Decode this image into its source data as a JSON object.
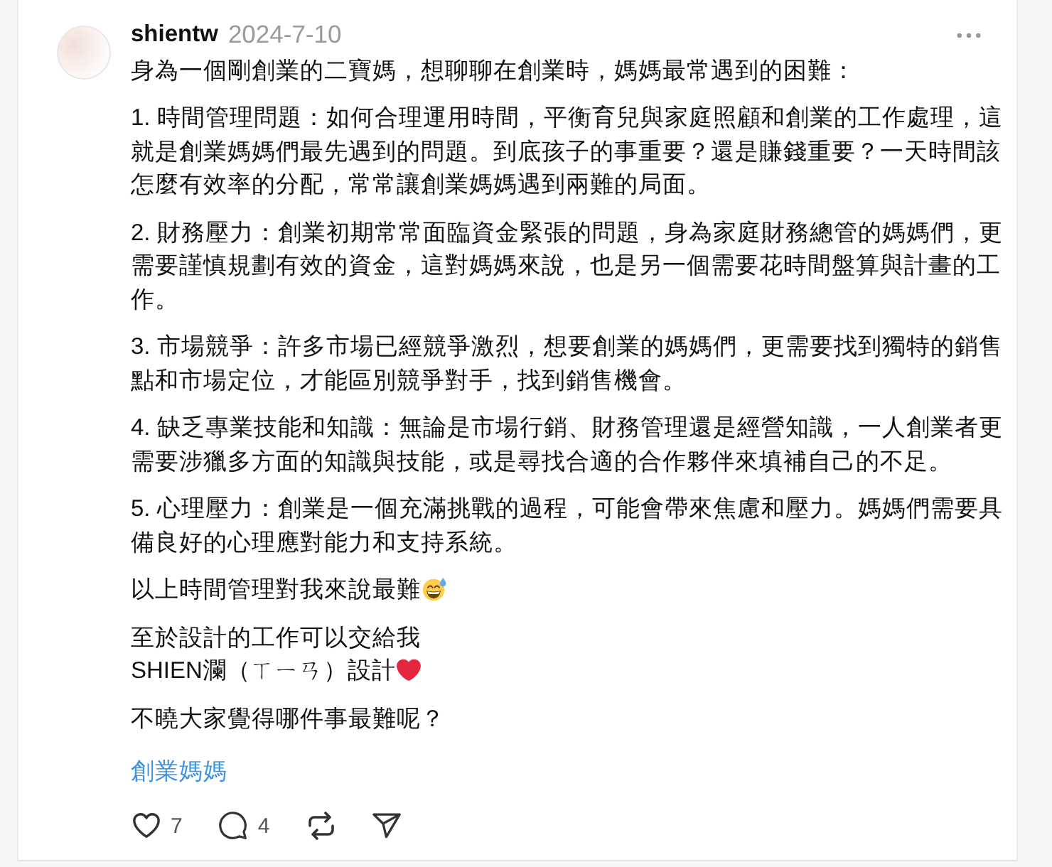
{
  "post": {
    "author": "shientw",
    "date": "2024-7-10",
    "paragraphs": [
      {
        "kind": "text",
        "lines": [
          "身為一個剛創業的二寶媽，想聊聊在創業時，媽媽最常遇到的困難："
        ]
      },
      {
        "kind": "text",
        "lines": [
          "1. 時間管理問題：如何合理運用時間，平衡育兒與家庭照顧和創業的工作處理，這就是創業媽媽們最先遇到的問題。到底孩子的事重要？還是賺錢重要？一天時間該怎麼有效率的分配，常常讓創業媽媽遇到兩難的局面。"
        ]
      },
      {
        "kind": "text",
        "lines": [
          "2. 財務壓力：創業初期常常面臨資金緊張的問題，身為家庭財務總管的媽媽們，更需要謹慎規劃有效的資金，這對媽媽來說，也是另一個需要花時間盤算與計畫的工作。"
        ]
      },
      {
        "kind": "text",
        "lines": [
          "3. 市場競爭：許多市場已經競爭激烈，想要創業的媽媽們，更需要找到獨特的銷售點和市場定位，才能區別競爭對手，找到銷售機會。"
        ]
      },
      {
        "kind": "text",
        "lines": [
          "4. 缺乏專業技能和知識：無論是市場行銷、財務管理還是經營知識，一人創業者更需要涉獵多方面的知識與技能，或是尋找合適的合作夥伴來填補自己的不足。"
        ]
      },
      {
        "kind": "text",
        "lines": [
          "5. 心理壓力：創業是一個充滿挑戰的過程，可能會帶來焦慮和壓力。媽媽們需要具備良好的心理應對能力和支持系統。"
        ]
      },
      {
        "kind": "smiley",
        "lines": [
          "以上時間管理對我來說最難"
        ]
      },
      {
        "kind": "heart",
        "lines": [
          "至於設計的工作可以交給我",
          "SHIEN瀾（ㄒㄧㄢ）設計"
        ]
      },
      {
        "kind": "text",
        "lines": [
          "不曉大家覺得哪件事最難呢？"
        ]
      }
    ],
    "hashtag": "創業媽媽",
    "actions": [
      {
        "kind": "like",
        "count": "7"
      },
      {
        "kind": "reply",
        "count": "4"
      },
      {
        "kind": "repost"
      },
      {
        "kind": "share"
      }
    ]
  }
}
